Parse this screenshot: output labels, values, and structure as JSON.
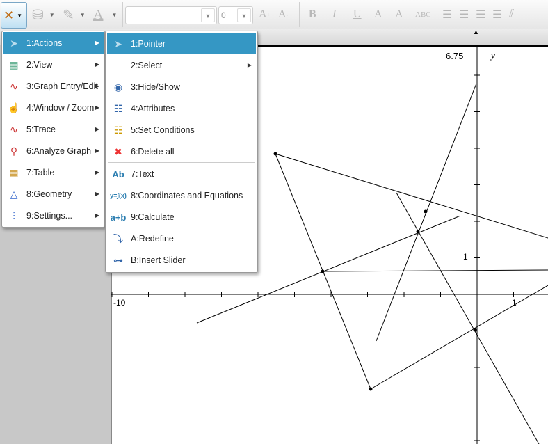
{
  "toolbar": {
    "font_size_value": "0",
    "font_name_value": "",
    "buttons": [
      "bold",
      "italic",
      "underline",
      "superscript",
      "subscript",
      "strikethrough",
      "align-left",
      "align-center",
      "align-right",
      "justify",
      "clear-format"
    ],
    "labels": {
      "bold": "B",
      "italic": "I",
      "underline": "U",
      "super": "A",
      "sub": "A",
      "abc": "ABC",
      "grow": "A",
      "shrink": "A",
      "text_color": "A"
    }
  },
  "menu": {
    "items": [
      {
        "label": "1:Actions",
        "icon": "pointer-icon"
      },
      {
        "label": "2:View",
        "icon": "view-icon"
      },
      {
        "label": "3:Graph Entry/Edit",
        "icon": "graph-entry-icon"
      },
      {
        "label": "4:Window / Zoom",
        "icon": "window-zoom-icon"
      },
      {
        "label": "5:Trace",
        "icon": "trace-icon"
      },
      {
        "label": "6:Analyze Graph",
        "icon": "analyze-graph-icon"
      },
      {
        "label": "7:Table",
        "icon": "table-icon"
      },
      {
        "label": "8:Geometry",
        "icon": "geometry-icon"
      },
      {
        "label": "9:Settings...",
        "icon": "settings-icon"
      }
    ]
  },
  "submenu": {
    "items": [
      {
        "label": "1:Pointer",
        "icon": "pointer-icon"
      },
      {
        "label": "2:Select",
        "icon": ""
      },
      {
        "label": "3:Hide/Show",
        "icon": "eye-icon"
      },
      {
        "label": "4:Attributes",
        "icon": "attributes-icon"
      },
      {
        "label": "5:Set Conditions",
        "icon": "set-conditions-icon"
      },
      {
        "label": "6:Delete all",
        "icon": "delete-icon"
      },
      {
        "label": "7:Text",
        "icon": "text-icon",
        "glyph": "Ab"
      },
      {
        "label": "8:Coordinates and Equations",
        "icon": "coordinates-icon",
        "glyph": "y=∫(x)"
      },
      {
        "label": "9:Calculate",
        "icon": "calculate-icon",
        "glyph": "a+b"
      },
      {
        "label": "A:Redefine",
        "icon": "redefine-icon"
      },
      {
        "label": "B:Insert Slider",
        "icon": "slider-icon"
      }
    ]
  },
  "graph": {
    "x_min_label": "-10",
    "x_tick_label": "1",
    "y_max_label": "6.75",
    "y_tick_label": "1",
    "y_axis_label": "y"
  },
  "colors": {
    "accent": "#3597c4"
  }
}
